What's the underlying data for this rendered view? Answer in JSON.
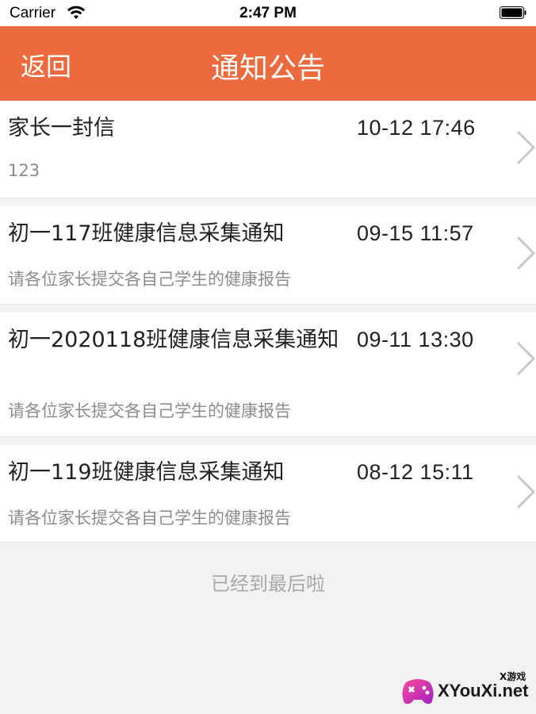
{
  "status_bar": {
    "carrier": "Carrier",
    "time": "2:47 PM",
    "wifi_icon": "wifi-icon",
    "battery_icon": "battery-icon"
  },
  "nav": {
    "back_label": "返回",
    "title": "通知公告",
    "background_color": "#ec6b3e"
  },
  "notices": [
    {
      "title": "家长一封信",
      "time": "10-12 17:46",
      "desc": "123"
    },
    {
      "title": "初一117班健康信息采集通知",
      "time": "09-15 11:57",
      "desc": "请各位家长提交各自己学生的健康报告"
    },
    {
      "title": "初一2020118班健康信息采集通知",
      "time": "09-11 13:30",
      "desc": "请各位家长提交各自己学生的健康报告"
    },
    {
      "title": "初一119班健康信息采集通知",
      "time": "08-12 15:11",
      "desc": "请各位家长提交各自己学生的健康报告"
    }
  ],
  "footer": {
    "end_text": "已经到最后啦"
  },
  "watermark": {
    "main": "XYouXi.net",
    "sub": "X游戏"
  }
}
